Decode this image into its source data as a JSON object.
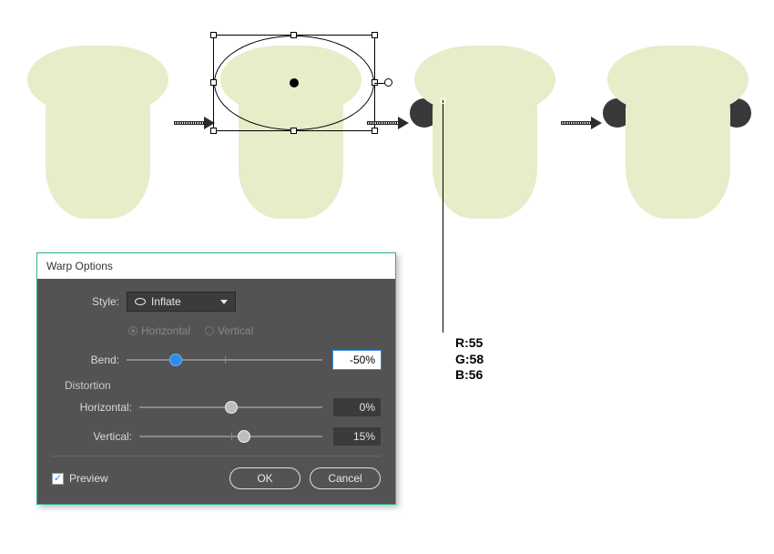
{
  "dialog": {
    "title": "Warp Options",
    "styleLabel": "Style:",
    "styleValue": "Inflate",
    "orientation": {
      "horizontal": "Horizontal",
      "vertical": "Vertical",
      "selected": "horizontal"
    },
    "bend": {
      "label": "Bend:",
      "value": "-50%",
      "pos": 25
    },
    "distortionLabel": "Distortion",
    "distH": {
      "label": "Horizontal:",
      "value": "0%",
      "pos": 50
    },
    "distV": {
      "label": "Vertical:",
      "value": "15%",
      "pos": 57
    },
    "preview": {
      "label": "Preview",
      "checked": true
    },
    "ok": "OK",
    "cancel": "Cancel"
  },
  "rgb": {
    "r": "R:55",
    "g": "G:58",
    "b": "B:56"
  }
}
